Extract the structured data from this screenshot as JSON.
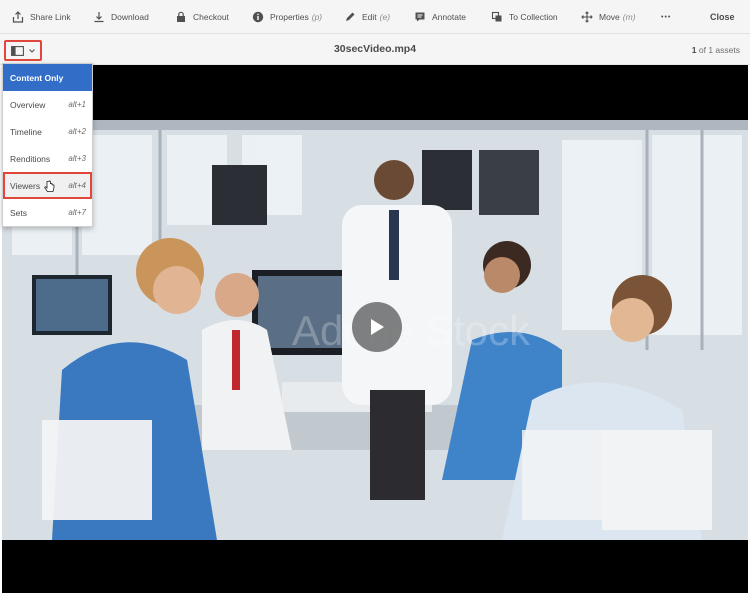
{
  "toolbar": {
    "share_link": "Share Link",
    "download": "Download",
    "checkout": "Checkout",
    "properties": "Properties",
    "properties_key": "(p)",
    "edit": "Edit",
    "edit_key": "(e)",
    "annotate": "Annotate",
    "to_collection": "To Collection",
    "move": "Move",
    "move_key": "(m)",
    "more": "•••",
    "close": "Close"
  },
  "header": {
    "title": "30secVideo.mp4",
    "count_current": "1",
    "count_rest": "of 1 assets"
  },
  "rail_menu": {
    "items": [
      {
        "label": "Content Only",
        "shortcut": ""
      },
      {
        "label": "Overview",
        "shortcut": "alt+1"
      },
      {
        "label": "Timeline",
        "shortcut": "alt+2"
      },
      {
        "label": "Renditions",
        "shortcut": "alt+3"
      },
      {
        "label": "Viewers",
        "shortcut": "alt+4"
      },
      {
        "label": "Sets",
        "shortcut": "alt+7"
      }
    ]
  },
  "video": {
    "watermark": "Adobe Stock"
  },
  "colors": {
    "accent": "#326ec8",
    "highlight": "#e0463c"
  }
}
